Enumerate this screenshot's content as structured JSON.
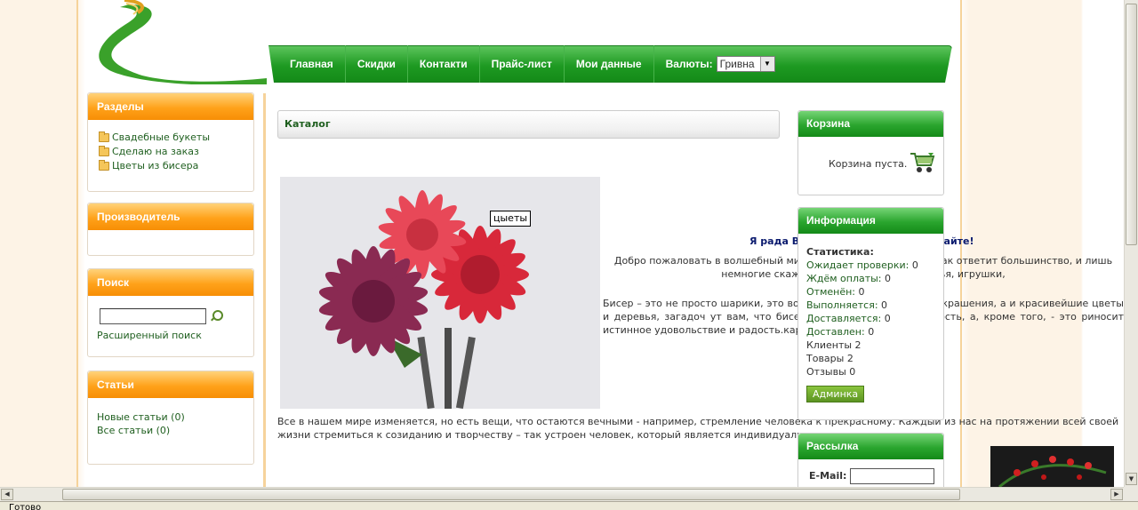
{
  "nav": {
    "items": [
      "Главная",
      "Скидки",
      "Контакти",
      "Прайс-лист",
      "Мои данные"
    ],
    "currency_label": "Валюты:",
    "currency_value": "Гривна"
  },
  "sections": {
    "title": "Разделы",
    "items": [
      "Свадебные букеты",
      "Сделаю на заказ",
      "Цветы из бисера"
    ]
  },
  "manufacturer": {
    "title": "Производитель"
  },
  "search": {
    "title": "Поиск",
    "advanced_link": "Расширенный поиск"
  },
  "articles": {
    "title": "Статьи",
    "new": "Новые статьи (0)",
    "all": "Все статьи (0)"
  },
  "catalog": {
    "title": "Каталог",
    "image_tooltip": "цыеты"
  },
  "welcome": {
    "title_start": "Я рада Ва",
    "title_end": "сайте!",
    "text": "Добро пожаловать в волшебный мир б                                                    арики с отверстием\" - так ответит большинство, и лишь немногие скажут,                                                 стерные цветы и деревья, игрушки,",
    "beads": "Бисер – это не просто шарики, это волше                                                  я не только женские украшения, а и красивейшие цветы и деревья, загадоч                                                ут вам, что бисер – это отдельная реальность, а, кроме того, - это                                                    риносит истинное удовольствие и радость.картины…",
    "bottom": "Все в нашем мире изменяется, но есть вещи, что остаются вечными - например, стремление человека к прекрасному. Каждый из нас на протяжении всей своей жизни стремиться к созиданию и творчеству – так устроен человек, который является индивидуальностью"
  },
  "cart": {
    "title": "Корзина",
    "empty_text": "Корзина пуста."
  },
  "info": {
    "title": "Информация",
    "stats_title": "Статистика:",
    "links": [
      {
        "label": "Ожидает проверки:",
        "value": "0"
      },
      {
        "label": "Ждём оплаты:",
        "value": "0"
      },
      {
        "label": "Отменён:",
        "value": "0"
      },
      {
        "label": "Выполняется:",
        "value": "0"
      },
      {
        "label": "Доставляется:",
        "value": "0"
      },
      {
        "label": "Доставлен:",
        "value": "0"
      }
    ],
    "plain": [
      "Клиенты 2",
      "Товары 2",
      "Отзывы 0"
    ],
    "admin_button": "Админка"
  },
  "newsletter": {
    "title": "Рассылка",
    "email_label": "E-Mail:"
  },
  "status": {
    "text": "Готово"
  },
  "colors": {
    "nav_green": "#1e9a22",
    "box_orange": "#ffa21a",
    "link_green": "#1f5f1f",
    "welcome_blue": "#0a1a6e"
  }
}
